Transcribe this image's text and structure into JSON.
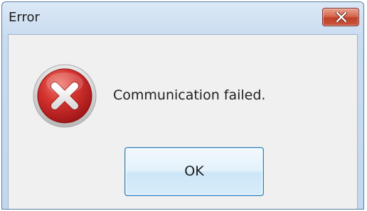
{
  "window": {
    "title": "Error"
  },
  "icons": {
    "close": "close-icon",
    "error": "error-icon"
  },
  "dialog": {
    "message": "Communication failed.",
    "ok_label": "OK"
  },
  "colors": {
    "title_bar": "#c9dcf0",
    "close_button": "#c9553a",
    "error_icon": "#c8262a",
    "ok_border": "#3c7fb1"
  }
}
